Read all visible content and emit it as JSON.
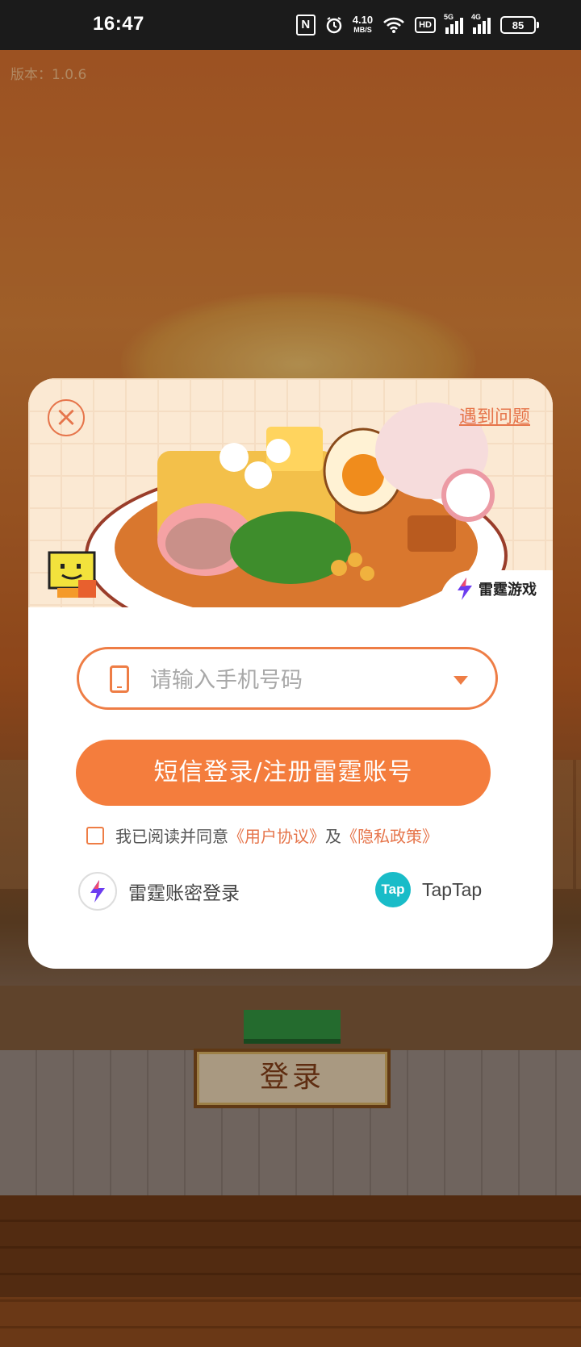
{
  "status_bar": {
    "time": "16:47",
    "nfc": "N",
    "speed_value": "4.10",
    "speed_unit": "MB/S",
    "hd": "HD",
    "sim1": "5G",
    "sim2": "4G",
    "battery": "85"
  },
  "game": {
    "version": "版本：1.0.6",
    "login_label": "登录"
  },
  "modal": {
    "close_icon": "close-circle",
    "help_link": "遇到问题",
    "brand_name": "雷霆游戏",
    "phone_placeholder": "请输入手机号码",
    "sms_login_label": "短信登录/注册雷霆账号",
    "agreement": {
      "prefix": "我已阅读并同意",
      "user_agreement": "《用户协议》",
      "and": "及",
      "privacy_policy": "《隐私政策》"
    },
    "alt_logins": {
      "thunder_label": "雷霆账密登录",
      "taptap_logo": "Tap",
      "taptap_label": "TapTap"
    }
  },
  "colors": {
    "accent": "#f47d3d",
    "link": "#e6754b",
    "taptap": "#19bcc8"
  }
}
